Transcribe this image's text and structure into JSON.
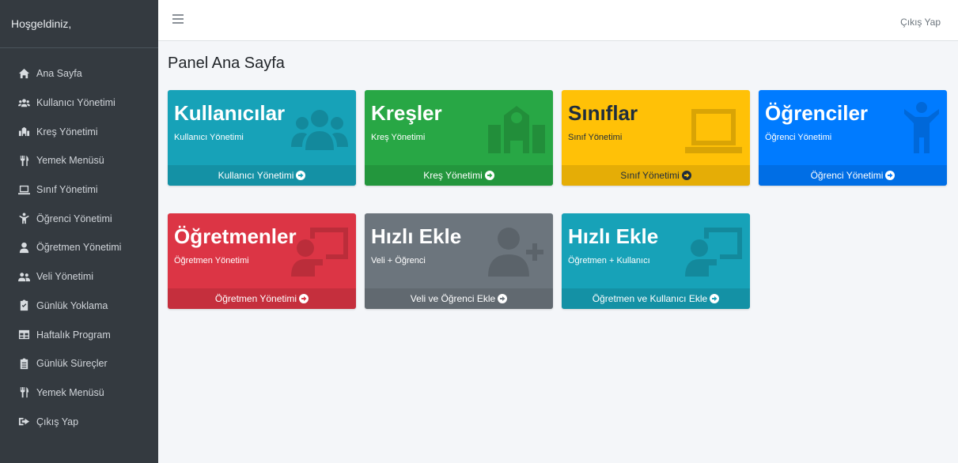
{
  "sidebar": {
    "welcome": "Hoşgeldiniz,",
    "items": [
      {
        "label": "Ana Sayfa",
        "icon": "home-icon"
      },
      {
        "label": "Kullanıcı Yönetimi",
        "icon": "users-icon"
      },
      {
        "label": "Kreş Yönetimi",
        "icon": "school-icon"
      },
      {
        "label": "Yemek Menüsü",
        "icon": "utensils-icon"
      },
      {
        "label": "Sınıf Yönetimi",
        "icon": "laptop-icon"
      },
      {
        "label": "Öğrenci Yönetimi",
        "icon": "child-icon"
      },
      {
        "label": "Öğretmen Yönetimi",
        "icon": "user-tie-icon"
      },
      {
        "label": "Veli Yönetimi",
        "icon": "user-friends-icon"
      },
      {
        "label": "Günlük Yoklama",
        "icon": "clipboard-check-icon"
      },
      {
        "label": "Haftalık Program",
        "icon": "table-icon"
      },
      {
        "label": "Günlük Süreçler",
        "icon": "clipboard-list-icon"
      },
      {
        "label": "Yemek Menüsü",
        "icon": "utensils-icon"
      },
      {
        "label": "Çıkış Yap",
        "icon": "sign-out-icon"
      }
    ]
  },
  "topbar": {
    "logout": "Çıkış Yap"
  },
  "page": {
    "title": "Panel Ana Sayfa"
  },
  "cards": [
    {
      "title": "Kullanıcılar",
      "subtitle": "Kullanıcı Yönetimi",
      "footer": "Kullanıcı Yönetimi",
      "color": "#17a2b8",
      "icon": "users-icon"
    },
    {
      "title": "Kreşler",
      "subtitle": "Kreş Yönetimi",
      "footer": "Kreş Yönetimi",
      "color": "#28a745",
      "icon": "school-icon"
    },
    {
      "title": "Sınıflar",
      "subtitle": "Sınıf Yönetimi",
      "footer": "Sınıf Yönetimi",
      "color": "#ffc107",
      "icon": "laptop-icon"
    },
    {
      "title": "Öğrenciler",
      "subtitle": "Öğrenci Yönetimi",
      "footer": "Öğrenci Yönetimi",
      "color": "#007bff",
      "icon": "child-icon"
    },
    {
      "title": "Öğretmenler",
      "subtitle": "Öğretmen Yönetimi",
      "footer": "Öğretmen Yönetimi",
      "color": "#dc3545",
      "icon": "chalkboard-teacher-icon"
    },
    {
      "title": "Hızlı Ekle",
      "subtitle": "Veli + Öğrenci",
      "footer": "Veli ve Öğrenci Ekle",
      "color": "#6c757d",
      "icon": "user-plus-icon"
    },
    {
      "title": "Hızlı Ekle",
      "subtitle": "Öğretmen + Kullanıcı",
      "footer": "Öğretmen ve Kullanıcı Ekle",
      "color": "#17a2b8",
      "icon": "chalkboard-teacher-icon"
    }
  ]
}
